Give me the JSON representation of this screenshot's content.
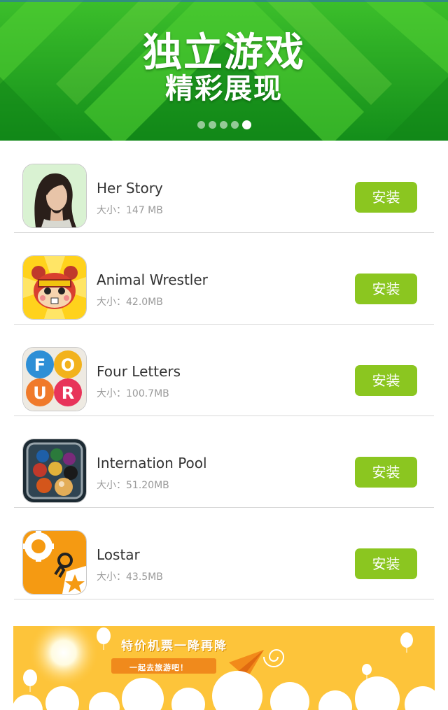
{
  "banner": {
    "line1": "独立游戏",
    "line2": "精彩展现",
    "slide_count": 5,
    "active_slide": 5,
    "colors": {
      "primary": "#1fa020",
      "light": "#5cd23a"
    }
  },
  "install_color": "#8bc620",
  "apps": [
    {
      "name": "Her Story",
      "size": "大小：147 MB",
      "install_label": "安装",
      "icon": "woman-portrait-icon"
    },
    {
      "name": "Animal Wrestler",
      "size": "大小：42.0MB",
      "install_label": "安装",
      "icon": "hamster-face-icon"
    },
    {
      "name": "Four Letters",
      "size": "大小：100.7MB",
      "install_label": "安装",
      "icon": "four-letters-icon"
    },
    {
      "name": "Internation Pool",
      "size": "大小：51.20MB",
      "install_label": "安装",
      "icon": "billiard-balls-icon"
    },
    {
      "name": "Lostar",
      "size": "大小：43.5MB",
      "install_label": "安装",
      "icon": "gear-star-icon"
    }
  ],
  "ad": {
    "title": "特价机票一降再降",
    "subtitle": "一起去旅游吧！",
    "background": "#fdc43a"
  }
}
